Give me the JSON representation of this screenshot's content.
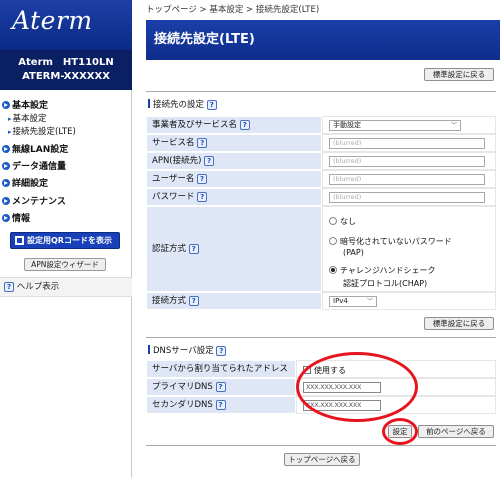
{
  "brand": {
    "logo": "Aterm",
    "model_line1": "Aterm　HT110LN",
    "model_line2": "ATERM-XXXXXX"
  },
  "sidebar": {
    "items": [
      {
        "label": "基本設定",
        "type": "section"
      },
      {
        "label": "基本設定",
        "type": "sub"
      },
      {
        "label": "接続先設定(LTE)",
        "type": "sub"
      },
      {
        "label": "無線LAN設定",
        "type": "section"
      },
      {
        "label": "データ通信量",
        "type": "section"
      },
      {
        "label": "詳細設定",
        "type": "section"
      },
      {
        "label": "メンテナンス",
        "type": "section"
      },
      {
        "label": "情報",
        "type": "section"
      }
    ],
    "qr_button": "設定用QRコードを表示",
    "apn_wizard": "APN設定ウィザード",
    "help": "ヘルプ表示"
  },
  "breadcrumb": "トップページ > 基本設定 > 接続先設定(LTE)",
  "page_title": "接続先設定(LTE)",
  "buttons": {
    "restore_default": "標準設定に戻る",
    "set": "設定",
    "prev_page": "前のページへ戻る",
    "top_page": "トップページへ戻る"
  },
  "connection_section": {
    "title": "接続先の設定",
    "fields": {
      "provider_label": "事業者及びサービス名",
      "provider_value": "手動設定",
      "service_name_label": "サービス名",
      "service_name_value": "(blurred)",
      "apn_label": "APN(接続先)",
      "apn_value": "(blurred)",
      "username_label": "ユーザー名",
      "username_value": "(blurred)",
      "password_label": "パスワード",
      "password_value": "(blurred)",
      "auth_label": "認証方式",
      "auth_options": [
        "なし",
        "暗号化されていないパスワード",
        "(PAP)",
        "チャレンジハンドシェーク",
        "認証プロトコル(CHAP)"
      ],
      "auth_selected": "CHAP",
      "conn_type_label": "接続方式",
      "conn_type_value": "IPv4"
    }
  },
  "dns_section": {
    "title": "DNSサーバ設定",
    "auto_label": "サーバから割り当てられたアドレス",
    "auto_checkbox_label": "使用する",
    "auto_checked": false,
    "primary_label": "プライマリDNS",
    "primary_value": "XXX.XXX.XXX.XXX",
    "secondary_label": "セカンダリDNS",
    "secondary_value": "XXX.XXX.XXX.XXX"
  },
  "help_icon": "?",
  "colors": {
    "header_blue": "#1a3fa8",
    "label_bg": "#dfe6f5",
    "annotation_red": "#e8141d"
  }
}
